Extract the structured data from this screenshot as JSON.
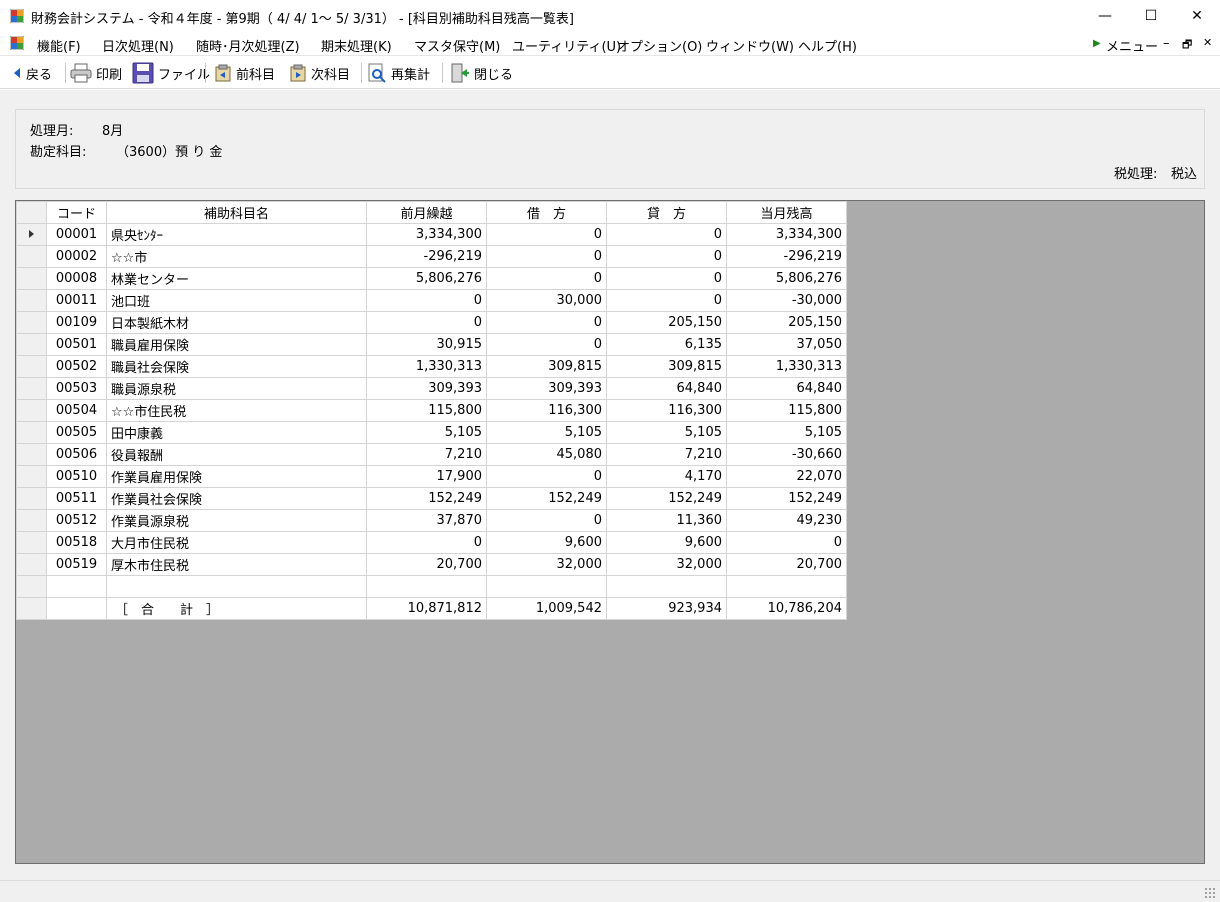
{
  "window": {
    "title": "財務会計システム - 令和４年度 - 第9期（ 4/ 4/ 1～ 5/ 3/31） - [科目別補助科目残高一覧表]",
    "minimize_glyph": "—",
    "maximize_glyph": "☐",
    "close_glyph": "✕"
  },
  "menubar": {
    "items": [
      "機能(F)",
      "日次処理(N)",
      "随時･月次処理(Z)",
      "期末処理(K)",
      "マスタ保守(M)",
      "ユーティリティ(U)",
      "オプション(O)",
      "ウィンドウ(W)",
      "ヘルプ(H)"
    ],
    "menu_label": "メニュー",
    "child_min": "–",
    "child_restore": "🗗",
    "child_close": "✕"
  },
  "toolbar": {
    "back": "戻る",
    "print": "印刷",
    "file": "ファイル",
    "prev_account": "前科目",
    "next_account": "次科目",
    "recalc": "再集計",
    "close": "閉じる"
  },
  "info": {
    "month_label": "処理月:",
    "month_value": "8月",
    "account_label": "勘定科目:",
    "account_value": "（3600）預 り 金",
    "tax_label": "税処理:",
    "tax_value": "税込"
  },
  "grid": {
    "headers": [
      "コード",
      "補助科目名",
      "前月繰越",
      "借　方",
      "貸　方",
      "当月残高"
    ],
    "rows": [
      [
        "00001",
        "県央ｾﾝﾀｰ",
        "3,334,300",
        "0",
        "0",
        "3,334,300"
      ],
      [
        "00002",
        "☆☆市",
        "-296,219",
        "0",
        "0",
        "-296,219"
      ],
      [
        "00008",
        "林業センター",
        "5,806,276",
        "0",
        "0",
        "5,806,276"
      ],
      [
        "00011",
        "池口班",
        "0",
        "30,000",
        "0",
        "-30,000"
      ],
      [
        "00109",
        "日本製紙木材",
        "0",
        "0",
        "205,150",
        "205,150"
      ],
      [
        "00501",
        "職員雇用保険",
        "30,915",
        "0",
        "6,135",
        "37,050"
      ],
      [
        "00502",
        "職員社会保険",
        "1,330,313",
        "309,815",
        "309,815",
        "1,330,313"
      ],
      [
        "00503",
        "職員源泉税",
        "309,393",
        "309,393",
        "64,840",
        "64,840"
      ],
      [
        "00504",
        "☆☆市住民税",
        "115,800",
        "116,300",
        "116,300",
        "115,800"
      ],
      [
        "00505",
        "田中康義",
        "5,105",
        "5,105",
        "5,105",
        "5,105"
      ],
      [
        "00506",
        "役員報酬",
        "7,210",
        "45,080",
        "7,210",
        "-30,660"
      ],
      [
        "00510",
        "作業員雇用保険",
        "17,900",
        "0",
        "4,170",
        "22,070"
      ],
      [
        "00511",
        "作業員社会保険",
        "152,249",
        "152,249",
        "152,249",
        "152,249"
      ],
      [
        "00512",
        "作業員源泉税",
        "37,870",
        "0",
        "11,360",
        "49,230"
      ],
      [
        "00518",
        "大月市住民税",
        "0",
        "9,600",
        "9,600",
        "0"
      ],
      [
        "00519",
        "厚木市住民税",
        "20,700",
        "32,000",
        "32,000",
        "20,700"
      ]
    ],
    "total": {
      "label": "［　合　　計　］",
      "prev": "10,871,812",
      "debit": "1,009,542",
      "credit": "923,934",
      "balance": "10,786,204"
    }
  }
}
